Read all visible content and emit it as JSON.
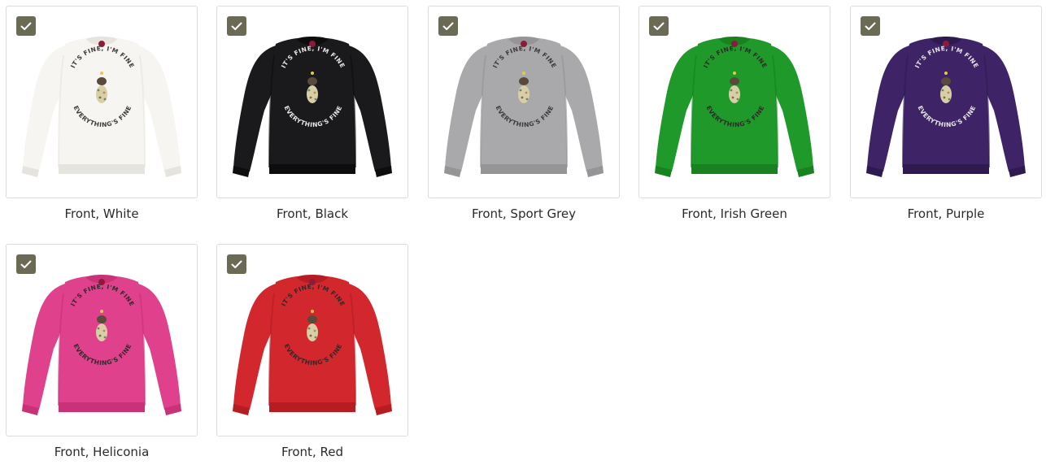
{
  "items": [
    {
      "label": "Front, White",
      "color": "#f6f5f1",
      "shade": "#e6e4de",
      "text_color": "#3a3a3a",
      "selected": true
    },
    {
      "label": "Front, Black",
      "color": "#1a1a1c",
      "shade": "#0d0d0e",
      "text_color": "#e8e8e8",
      "selected": true
    },
    {
      "label": "Front, Sport Grey",
      "color": "#a9a9ab",
      "shade": "#959597",
      "text_color": "#3a3a3a",
      "selected": true
    },
    {
      "label": "Front, Irish Green",
      "color": "#1f9a2a",
      "shade": "#17821f",
      "text_color": "#2b2b2b",
      "selected": true
    },
    {
      "label": "Front, Purple",
      "color": "#3e2466",
      "shade": "#2f1a50",
      "text_color": "#e8e8e8",
      "selected": true
    },
    {
      "label": "Front, Heliconia",
      "color": "#e0418c",
      "shade": "#c93277",
      "text_color": "#2b2b2b",
      "selected": true
    },
    {
      "label": "Front, Red",
      "color": "#d2272d",
      "shade": "#b51d22",
      "text_color": "#2b2b2b",
      "selected": true
    }
  ],
  "design": {
    "top_text": "IT'S FINE, I'M FINE",
    "bottom_text": "EVERYTHING'S FINE"
  },
  "accent": "#6b6b55"
}
